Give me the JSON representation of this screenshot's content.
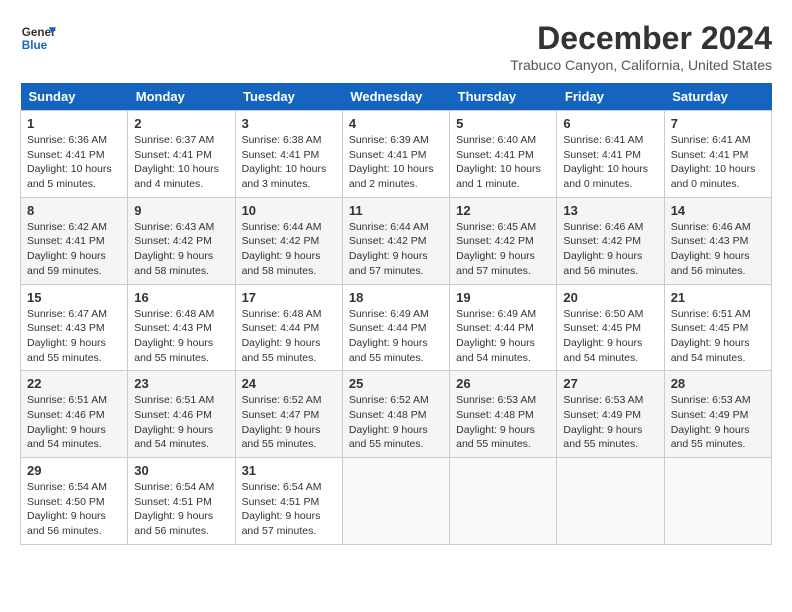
{
  "header": {
    "logo_line1": "General",
    "logo_line2": "Blue",
    "month_title": "December 2024",
    "subtitle": "Trabuco Canyon, California, United States"
  },
  "weekdays": [
    "Sunday",
    "Monday",
    "Tuesday",
    "Wednesday",
    "Thursday",
    "Friday",
    "Saturday"
  ],
  "weeks": [
    [
      {
        "day": "1",
        "info": "Sunrise: 6:36 AM\nSunset: 4:41 PM\nDaylight: 10 hours\nand 5 minutes."
      },
      {
        "day": "2",
        "info": "Sunrise: 6:37 AM\nSunset: 4:41 PM\nDaylight: 10 hours\nand 4 minutes."
      },
      {
        "day": "3",
        "info": "Sunrise: 6:38 AM\nSunset: 4:41 PM\nDaylight: 10 hours\nand 3 minutes."
      },
      {
        "day": "4",
        "info": "Sunrise: 6:39 AM\nSunset: 4:41 PM\nDaylight: 10 hours\nand 2 minutes."
      },
      {
        "day": "5",
        "info": "Sunrise: 6:40 AM\nSunset: 4:41 PM\nDaylight: 10 hours\nand 1 minute."
      },
      {
        "day": "6",
        "info": "Sunrise: 6:41 AM\nSunset: 4:41 PM\nDaylight: 10 hours\nand 0 minutes."
      },
      {
        "day": "7",
        "info": "Sunrise: 6:41 AM\nSunset: 4:41 PM\nDaylight: 10 hours\nand 0 minutes."
      }
    ],
    [
      {
        "day": "8",
        "info": "Sunrise: 6:42 AM\nSunset: 4:41 PM\nDaylight: 9 hours\nand 59 minutes."
      },
      {
        "day": "9",
        "info": "Sunrise: 6:43 AM\nSunset: 4:42 PM\nDaylight: 9 hours\nand 58 minutes."
      },
      {
        "day": "10",
        "info": "Sunrise: 6:44 AM\nSunset: 4:42 PM\nDaylight: 9 hours\nand 58 minutes."
      },
      {
        "day": "11",
        "info": "Sunrise: 6:44 AM\nSunset: 4:42 PM\nDaylight: 9 hours\nand 57 minutes."
      },
      {
        "day": "12",
        "info": "Sunrise: 6:45 AM\nSunset: 4:42 PM\nDaylight: 9 hours\nand 57 minutes."
      },
      {
        "day": "13",
        "info": "Sunrise: 6:46 AM\nSunset: 4:42 PM\nDaylight: 9 hours\nand 56 minutes."
      },
      {
        "day": "14",
        "info": "Sunrise: 6:46 AM\nSunset: 4:43 PM\nDaylight: 9 hours\nand 56 minutes."
      }
    ],
    [
      {
        "day": "15",
        "info": "Sunrise: 6:47 AM\nSunset: 4:43 PM\nDaylight: 9 hours\nand 55 minutes."
      },
      {
        "day": "16",
        "info": "Sunrise: 6:48 AM\nSunset: 4:43 PM\nDaylight: 9 hours\nand 55 minutes."
      },
      {
        "day": "17",
        "info": "Sunrise: 6:48 AM\nSunset: 4:44 PM\nDaylight: 9 hours\nand 55 minutes."
      },
      {
        "day": "18",
        "info": "Sunrise: 6:49 AM\nSunset: 4:44 PM\nDaylight: 9 hours\nand 55 minutes."
      },
      {
        "day": "19",
        "info": "Sunrise: 6:49 AM\nSunset: 4:44 PM\nDaylight: 9 hours\nand 54 minutes."
      },
      {
        "day": "20",
        "info": "Sunrise: 6:50 AM\nSunset: 4:45 PM\nDaylight: 9 hours\nand 54 minutes."
      },
      {
        "day": "21",
        "info": "Sunrise: 6:51 AM\nSunset: 4:45 PM\nDaylight: 9 hours\nand 54 minutes."
      }
    ],
    [
      {
        "day": "22",
        "info": "Sunrise: 6:51 AM\nSunset: 4:46 PM\nDaylight: 9 hours\nand 54 minutes."
      },
      {
        "day": "23",
        "info": "Sunrise: 6:51 AM\nSunset: 4:46 PM\nDaylight: 9 hours\nand 54 minutes."
      },
      {
        "day": "24",
        "info": "Sunrise: 6:52 AM\nSunset: 4:47 PM\nDaylight: 9 hours\nand 55 minutes."
      },
      {
        "day": "25",
        "info": "Sunrise: 6:52 AM\nSunset: 4:48 PM\nDaylight: 9 hours\nand 55 minutes."
      },
      {
        "day": "26",
        "info": "Sunrise: 6:53 AM\nSunset: 4:48 PM\nDaylight: 9 hours\nand 55 minutes."
      },
      {
        "day": "27",
        "info": "Sunrise: 6:53 AM\nSunset: 4:49 PM\nDaylight: 9 hours\nand 55 minutes."
      },
      {
        "day": "28",
        "info": "Sunrise: 6:53 AM\nSunset: 4:49 PM\nDaylight: 9 hours\nand 55 minutes."
      }
    ],
    [
      {
        "day": "29",
        "info": "Sunrise: 6:54 AM\nSunset: 4:50 PM\nDaylight: 9 hours\nand 56 minutes."
      },
      {
        "day": "30",
        "info": "Sunrise: 6:54 AM\nSunset: 4:51 PM\nDaylight: 9 hours\nand 56 minutes."
      },
      {
        "day": "31",
        "info": "Sunrise: 6:54 AM\nSunset: 4:51 PM\nDaylight: 9 hours\nand 57 minutes."
      },
      {
        "day": "",
        "info": ""
      },
      {
        "day": "",
        "info": ""
      },
      {
        "day": "",
        "info": ""
      },
      {
        "day": "",
        "info": ""
      }
    ]
  ]
}
